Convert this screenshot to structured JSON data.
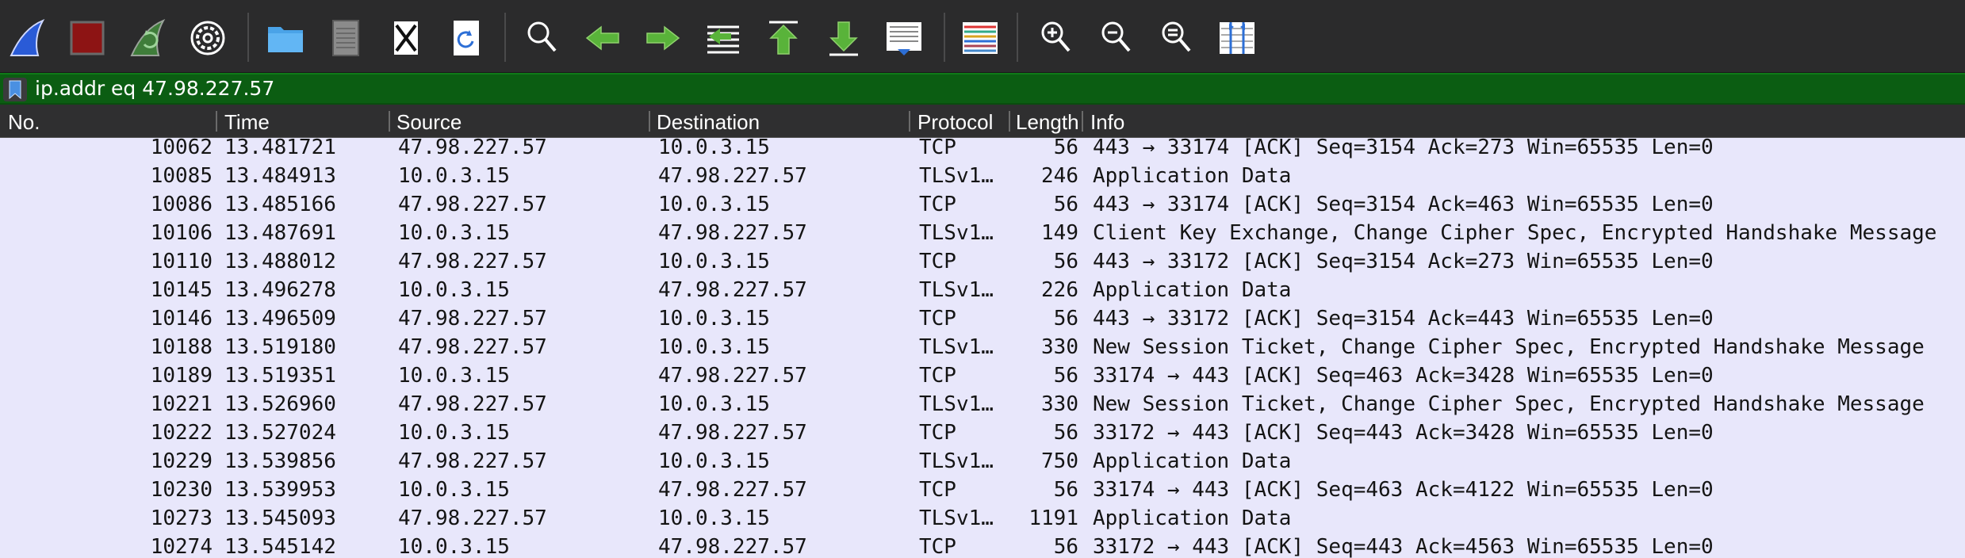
{
  "toolbar": {
    "buttons": [
      {
        "name": "start-capture-button",
        "icon": "shark-fin-icon"
      },
      {
        "name": "stop-capture-button",
        "icon": "stop-square-icon"
      },
      {
        "name": "restart-capture-button",
        "icon": "restart-fin-icon"
      },
      {
        "name": "capture-options-button",
        "icon": "gear-icon"
      },
      {
        "name": "open-file-button",
        "icon": "folder-icon"
      },
      {
        "name": "save-file-button",
        "icon": "file-icon"
      },
      {
        "name": "close-file-button",
        "icon": "file-close-icon"
      },
      {
        "name": "reload-file-button",
        "icon": "reload-icon"
      },
      {
        "name": "find-packet-button",
        "icon": "search-icon"
      },
      {
        "name": "go-back-button",
        "icon": "arrow-left-icon"
      },
      {
        "name": "go-forward-button",
        "icon": "arrow-right-icon"
      },
      {
        "name": "go-to-packet-button",
        "icon": "go-to-packet-icon"
      },
      {
        "name": "go-first-packet-button",
        "icon": "arrow-up-top-icon"
      },
      {
        "name": "go-last-packet-button",
        "icon": "arrow-down-bottom-icon"
      },
      {
        "name": "auto-scroll-button",
        "icon": "auto-scroll-icon"
      },
      {
        "name": "colorize-button",
        "icon": "colorize-lines-icon"
      },
      {
        "name": "zoom-in-button",
        "icon": "zoom-in-icon"
      },
      {
        "name": "zoom-out-button",
        "icon": "zoom-out-icon"
      },
      {
        "name": "zoom-reset-button",
        "icon": "zoom-reset-icon"
      },
      {
        "name": "resize-columns-button",
        "icon": "resize-columns-icon"
      }
    ]
  },
  "filter": {
    "value": "ip.addr eq 47.98.227.57",
    "bookmark_icon": "bookmark-icon",
    "background_color": "#0b5d12"
  },
  "columns": {
    "no": "No.",
    "time": "Time",
    "source": "Source",
    "destination": "Destination",
    "protocol": "Protocol",
    "length": "Length",
    "info": "Info"
  },
  "colors": {
    "row_background": "#e8e7fb",
    "header_background": "#2f2f30",
    "toolbar_background": "#2b2b2c"
  },
  "packets": [
    {
      "no": "10062",
      "time": "13.481721",
      "source": "47.98.227.57",
      "destination": "10.0.3.15",
      "protocol": "TCP",
      "length": "56",
      "info": "443 → 33174 [ACK] Seq=3154 Ack=273 Win=65535 Len=0"
    },
    {
      "no": "10085",
      "time": "13.484913",
      "source": "10.0.3.15",
      "destination": "47.98.227.57",
      "protocol": "TLSv1…",
      "length": "246",
      "info": "Application Data"
    },
    {
      "no": "10086",
      "time": "13.485166",
      "source": "47.98.227.57",
      "destination": "10.0.3.15",
      "protocol": "TCP",
      "length": "56",
      "info": "443 → 33174 [ACK] Seq=3154 Ack=463 Win=65535 Len=0"
    },
    {
      "no": "10106",
      "time": "13.487691",
      "source": "10.0.3.15",
      "destination": "47.98.227.57",
      "protocol": "TLSv1…",
      "length": "149",
      "info": "Client Key Exchange, Change Cipher Spec, Encrypted Handshake Message"
    },
    {
      "no": "10110",
      "time": "13.488012",
      "source": "47.98.227.57",
      "destination": "10.0.3.15",
      "protocol": "TCP",
      "length": "56",
      "info": "443 → 33172 [ACK] Seq=3154 Ack=273 Win=65535 Len=0"
    },
    {
      "no": "10145",
      "time": "13.496278",
      "source": "10.0.3.15",
      "destination": "47.98.227.57",
      "protocol": "TLSv1…",
      "length": "226",
      "info": "Application Data"
    },
    {
      "no": "10146",
      "time": "13.496509",
      "source": "47.98.227.57",
      "destination": "10.0.3.15",
      "protocol": "TCP",
      "length": "56",
      "info": "443 → 33172 [ACK] Seq=3154 Ack=443 Win=65535 Len=0"
    },
    {
      "no": "10188",
      "time": "13.519180",
      "source": "47.98.227.57",
      "destination": "10.0.3.15",
      "protocol": "TLSv1…",
      "length": "330",
      "info": "New Session Ticket, Change Cipher Spec, Encrypted Handshake Message"
    },
    {
      "no": "10189",
      "time": "13.519351",
      "source": "10.0.3.15",
      "destination": "47.98.227.57",
      "protocol": "TCP",
      "length": "56",
      "info": "33174 → 443 [ACK] Seq=463 Ack=3428 Win=65535 Len=0"
    },
    {
      "no": "10221",
      "time": "13.526960",
      "source": "47.98.227.57",
      "destination": "10.0.3.15",
      "protocol": "TLSv1…",
      "length": "330",
      "info": "New Session Ticket, Change Cipher Spec, Encrypted Handshake Message"
    },
    {
      "no": "10222",
      "time": "13.527024",
      "source": "10.0.3.15",
      "destination": "47.98.227.57",
      "protocol": "TCP",
      "length": "56",
      "info": "33172 → 443 [ACK] Seq=443 Ack=3428 Win=65535 Len=0"
    },
    {
      "no": "10229",
      "time": "13.539856",
      "source": "47.98.227.57",
      "destination": "10.0.3.15",
      "protocol": "TLSv1…",
      "length": "750",
      "info": "Application Data"
    },
    {
      "no": "10230",
      "time": "13.539953",
      "source": "10.0.3.15",
      "destination": "47.98.227.57",
      "protocol": "TCP",
      "length": "56",
      "info": "33174 → 443 [ACK] Seq=463 Ack=4122 Win=65535 Len=0"
    },
    {
      "no": "10273",
      "time": "13.545093",
      "source": "47.98.227.57",
      "destination": "10.0.3.15",
      "protocol": "TLSv1…",
      "length": "1191",
      "info": "Application Data"
    },
    {
      "no": "10274",
      "time": "13.545142",
      "source": "10.0.3.15",
      "destination": "47.98.227.57",
      "protocol": "TCP",
      "length": "56",
      "info": "33172 → 443 [ACK] Seq=443 Ack=4563 Win=65535 Len=0"
    }
  ]
}
